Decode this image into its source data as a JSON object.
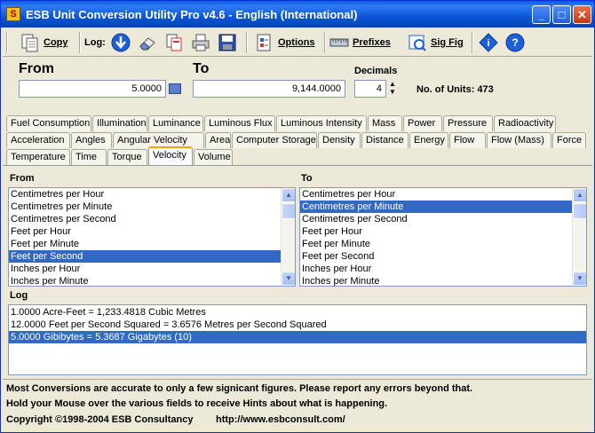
{
  "window": {
    "title": "ESB Unit Conversion Utility Pro v4.6 - English (International)",
    "app_icon": "S"
  },
  "toolbar": {
    "copy_label": "Copy",
    "log_label": "Log:",
    "options_label": "Options",
    "prefixes_label": "Prefixes",
    "sigfig_label": "Sig Fig"
  },
  "converter": {
    "from_label": "From",
    "to_label": "To",
    "from_value": "5.0000",
    "to_value": "9,144.0000",
    "decimals_label": "Decimals",
    "decimals_value": "4",
    "units_count": "No. of Units: 473"
  },
  "tabs": {
    "row1": [
      "Fuel Consumption",
      "Illumination",
      "Luminance",
      "Luminous Flux",
      "Luminous Intensity",
      "Mass",
      "Power",
      "Pressure",
      "Radioactivity"
    ],
    "row2": [
      "Acceleration",
      "Angles",
      "Angular Velocity",
      "Area",
      "Computer Storage",
      "Density",
      "Distance",
      "Energy",
      "Flow",
      "Flow (Mass)",
      "Force"
    ],
    "row3": [
      "Temperature",
      "Time",
      "Torque",
      "Velocity",
      "Volume"
    ],
    "active": "Velocity"
  },
  "from_list": {
    "label": "From",
    "items": [
      "Centimetres per Hour",
      "Centimetres per Minute",
      "Centimetres per Second",
      "Feet per Hour",
      "Feet per Minute",
      "Feet per Second",
      "Inches per Hour",
      "Inches per Minute"
    ],
    "selected": "Feet per Second"
  },
  "to_list": {
    "label": "To",
    "items": [
      "Centimetres per Hour",
      "Centimetres per Minute",
      "Centimetres per Second",
      "Feet per Hour",
      "Feet per Minute",
      "Feet per Second",
      "Inches per Hour",
      "Inches per Minute"
    ],
    "selected": "Centimetres per Minute"
  },
  "log": {
    "label": "Log",
    "entries": [
      "1.0000 Acre-Feet = 1,233.4818 Cubic Metres",
      "12.0000 Feet per Second Squared = 3.6576 Metres per Second Squared",
      "5.0000 Gibibytes = 5.3687 Gigabytes (10)"
    ],
    "selected_index": 2
  },
  "footer": {
    "line1": "Most Conversions are accurate to only a few signicant figures. Please report any errors beyond that.",
    "line2": "Hold your Mouse over the various fields to receive Hints about what is happening.",
    "copyright": "Copyright ©1998-2004  ESB Consultancy",
    "url": "http://www.esbconsult.com/"
  },
  "colors": {
    "selection": "#316ac5",
    "titlebar": "#0a5ae0",
    "active_tab_accent": "#ff9c00"
  }
}
